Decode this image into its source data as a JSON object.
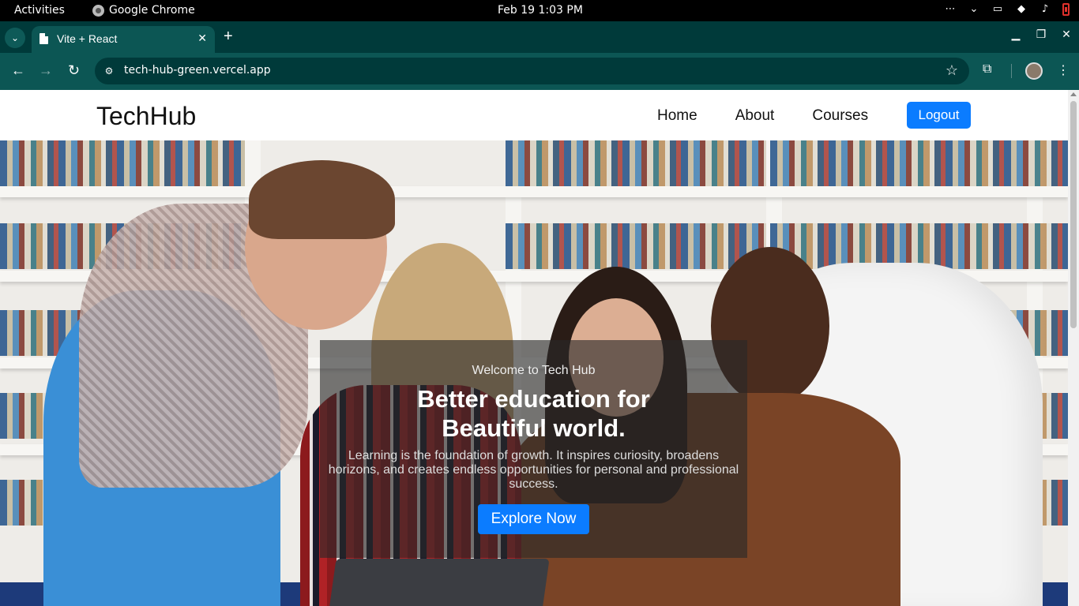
{
  "os": {
    "activities": "Activities",
    "app_name": "Google Chrome",
    "clock": "Feb 19  1:03 PM"
  },
  "browser": {
    "tab_title": "Vite + React",
    "url": "tech-hub-green.vercel.app"
  },
  "site": {
    "brand": "TechHub",
    "nav": [
      "Home",
      "About",
      "Courses"
    ],
    "logout_label": "Logout"
  },
  "hero": {
    "welcome": "Welcome to Tech Hub",
    "headline_line1": "Better education for",
    "headline_line2": "Beautiful world.",
    "body": "Learning is the foundation of growth. It inspires curiosity, broadens horizons, and creates endless opportunities for personal and professional success.",
    "cta_label": "Explore Now"
  },
  "colors": {
    "browser_frame": "#0c5654",
    "tabstrip": "#003a3a",
    "primary_button": "#0b7cff",
    "overlay": "rgba(40,40,40,0.62)"
  }
}
